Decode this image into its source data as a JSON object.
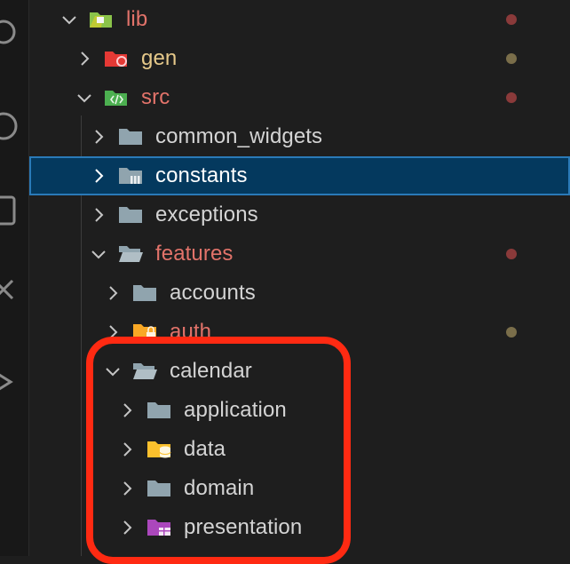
{
  "explorer": {
    "rows": [
      {
        "label": "lib",
        "expanded": true,
        "icon": "folder-lib-open-icon"
      },
      {
        "label": "gen",
        "expanded": false,
        "icon": "folder-generated-icon"
      },
      {
        "label": "src",
        "expanded": true,
        "icon": "folder-src-open-icon"
      },
      {
        "label": "common_widgets",
        "expanded": false,
        "icon": "folder-icon"
      },
      {
        "label": "constants",
        "expanded": false,
        "icon": "folder-constants-icon",
        "selected": true
      },
      {
        "label": "exceptions",
        "expanded": false,
        "icon": "folder-icon"
      },
      {
        "label": "features",
        "expanded": true,
        "icon": "folder-open-icon"
      },
      {
        "label": "accounts",
        "expanded": false,
        "icon": "folder-icon"
      },
      {
        "label": "auth",
        "expanded": false,
        "icon": "folder-auth-icon"
      },
      {
        "label": "calendar",
        "expanded": true,
        "icon": "folder-open-icon"
      },
      {
        "label": "application",
        "expanded": false,
        "icon": "folder-icon"
      },
      {
        "label": "data",
        "expanded": false,
        "icon": "folder-data-icon"
      },
      {
        "label": "domain",
        "expanded": false,
        "icon": "folder-icon"
      },
      {
        "label": "presentation",
        "expanded": false,
        "icon": "folder-presentation-icon"
      }
    ]
  },
  "colors": {
    "modified": "#e2736a",
    "generated": "#e6c98a",
    "selection": "#04395e",
    "highlight_box": "#ff2a12"
  }
}
